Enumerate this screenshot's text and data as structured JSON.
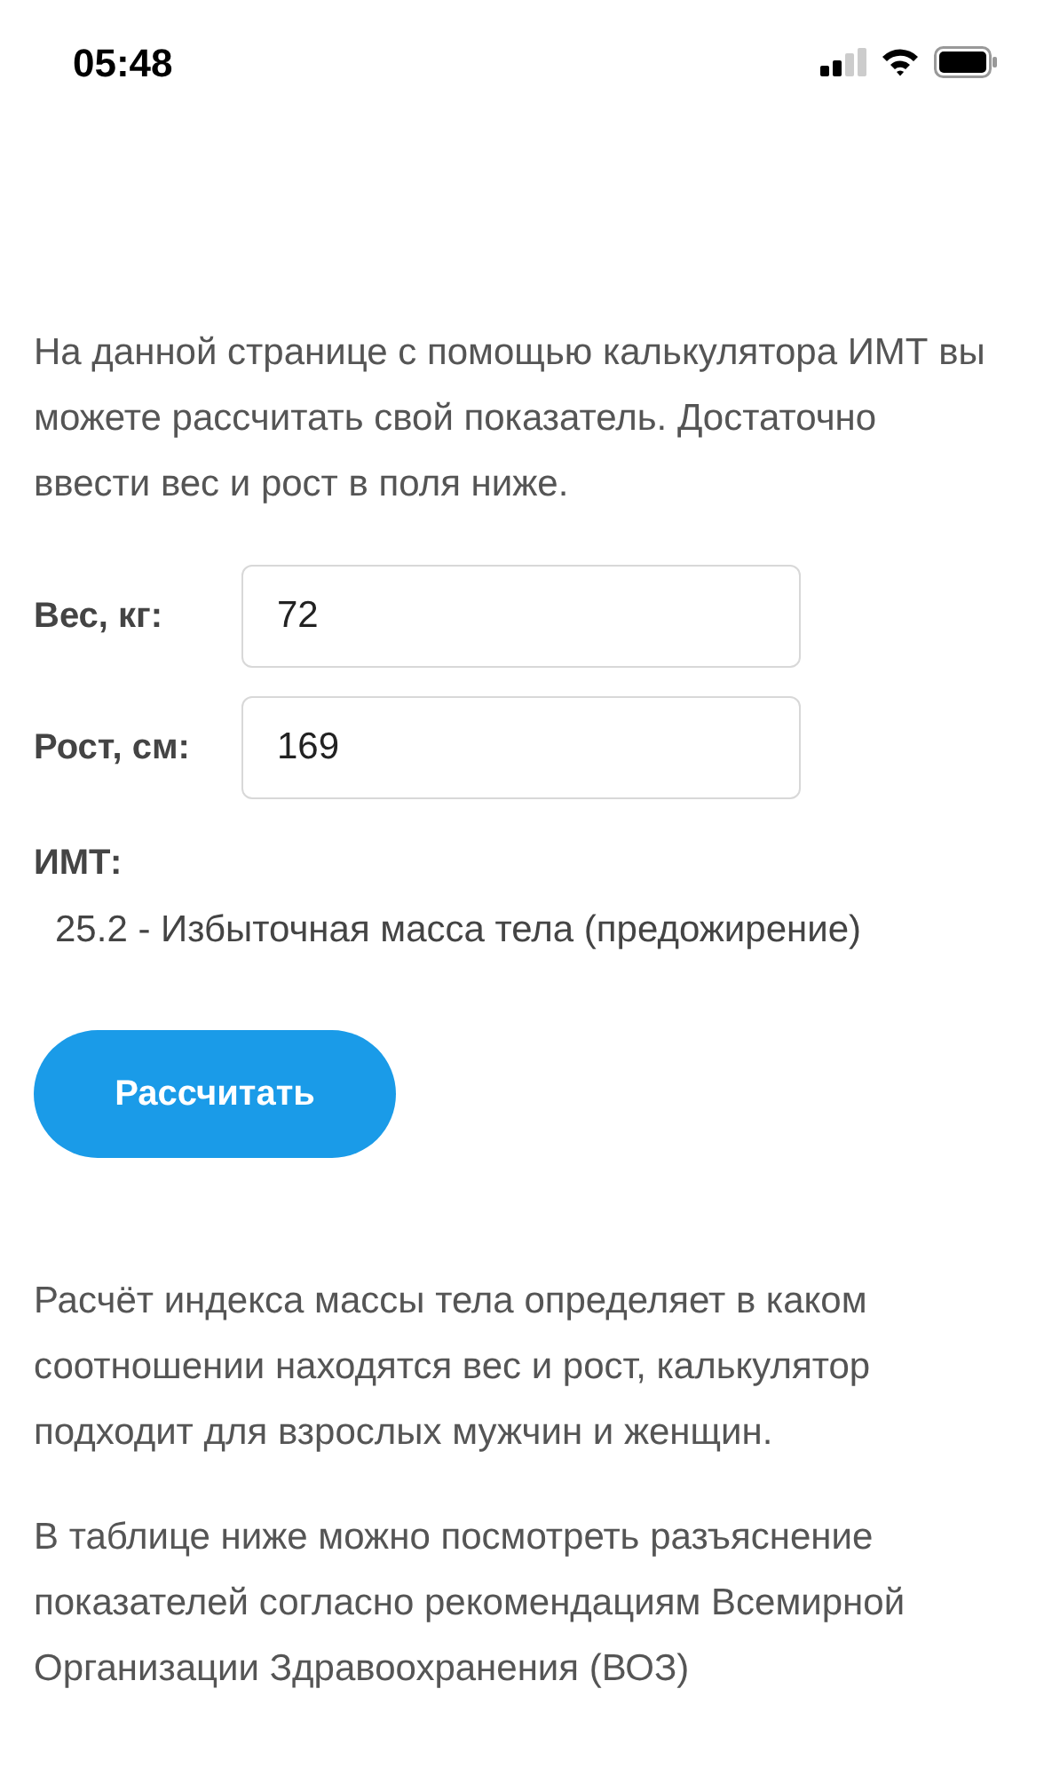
{
  "status_bar": {
    "time": "05:48"
  },
  "intro": "На данной странице с помощью калькулятора ИМТ вы можете рассчитать свой показатель. Достаточно ввести вес и рост в поля ниже.",
  "fields": [
    {
      "label": "Вес, кг:",
      "value": "72"
    },
    {
      "label": "Рост, см:",
      "value": "169"
    }
  ],
  "result": {
    "label": "ИМТ:",
    "value": "25.2 - Избыточная масса тела (предожирение)"
  },
  "button": "Рассчитать",
  "paragraphs": [
    "Расчёт индекса массы тела определяет в каком соотношении находятся вес и рост, калькулятор подходит для взрослых мужчин и женщин.",
    "В таблице ниже можно посмотреть разъяснение показателей согласно рекомендациям Всемирной Организации Здравоохранения (ВОЗ)"
  ]
}
